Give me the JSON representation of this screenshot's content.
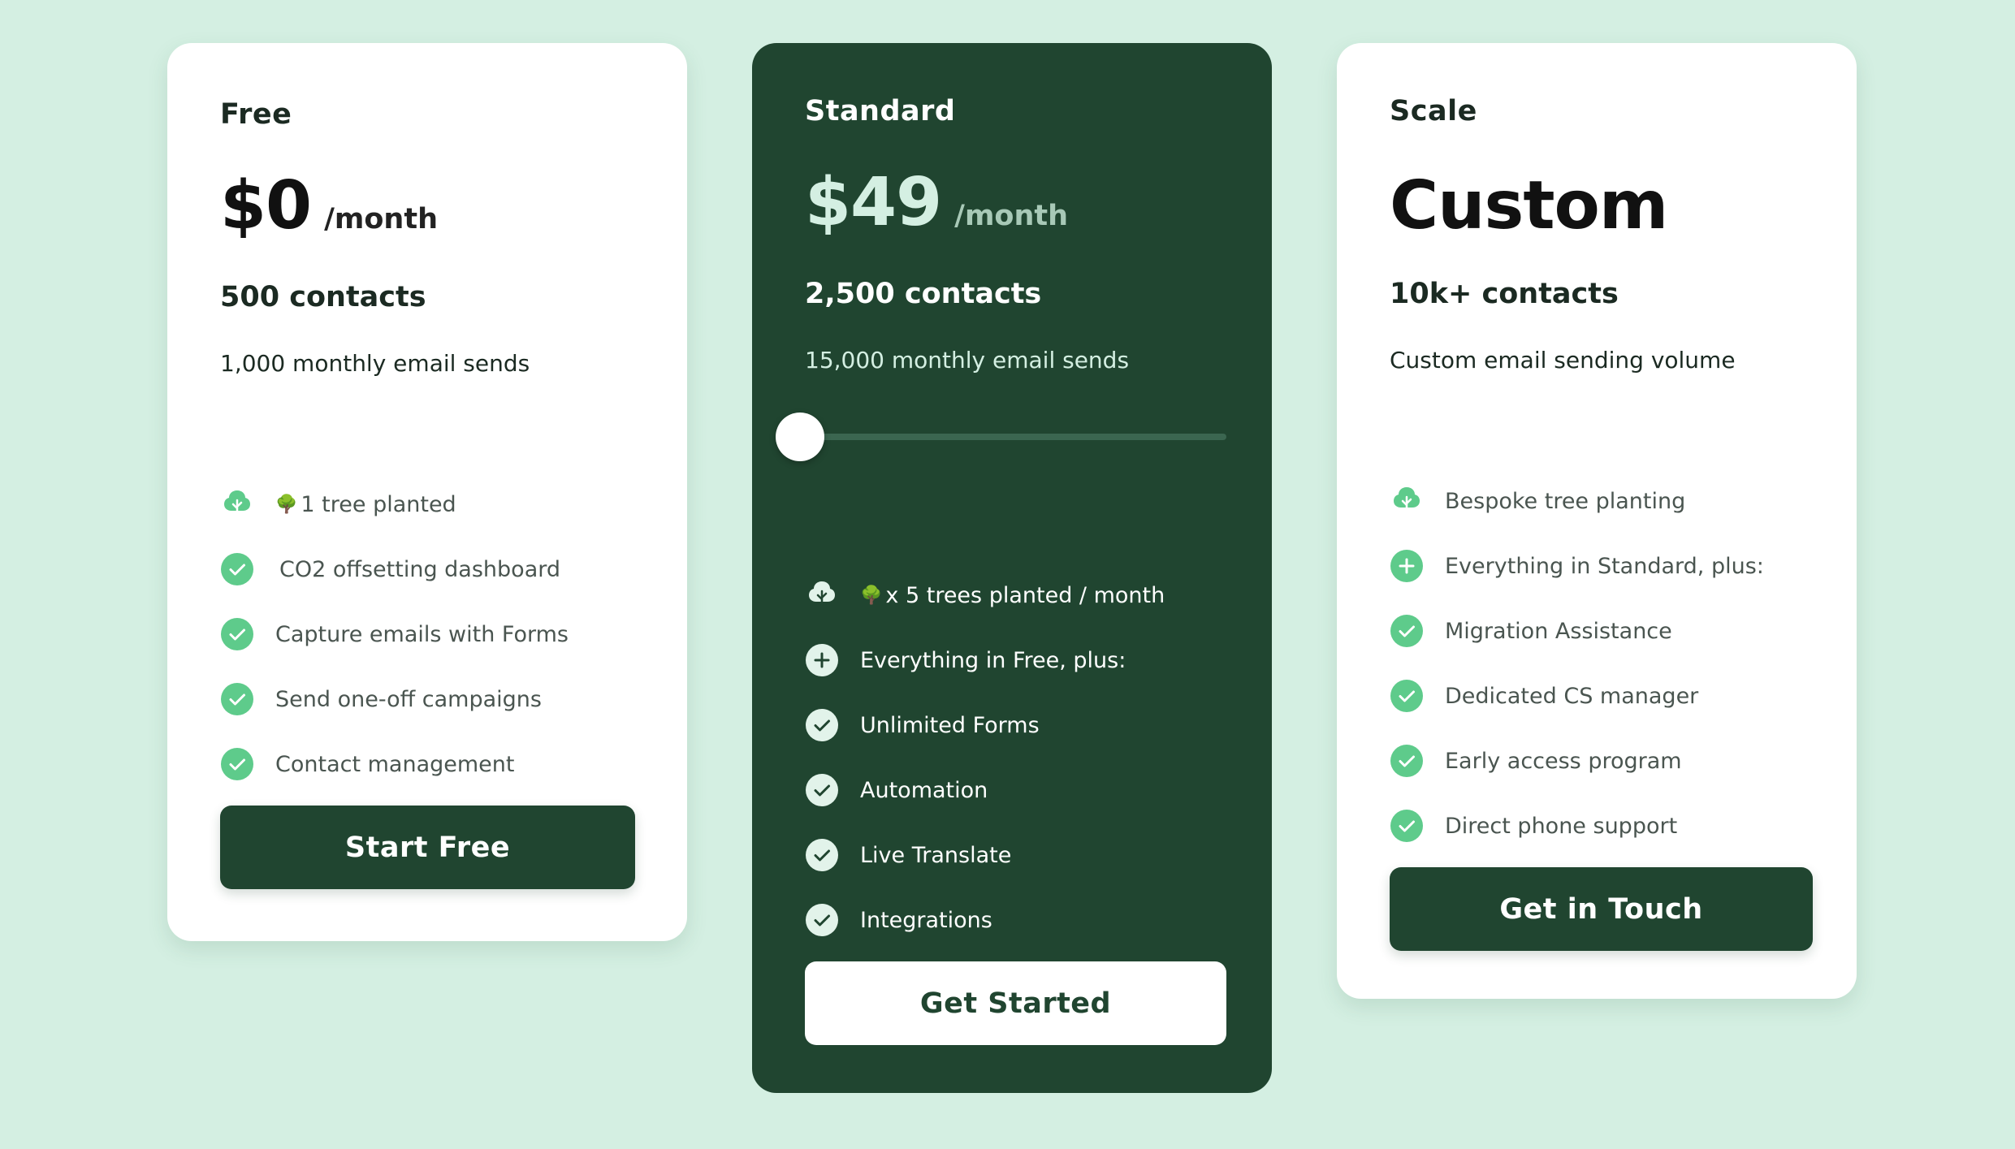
{
  "colors": {
    "page_bg": "#d4efe2",
    "dark_green": "#204530",
    "accent_green": "#5ecb8b",
    "price_standard": "#d4efe2"
  },
  "plans": [
    {
      "name": "Free",
      "price": "$0",
      "per": "/month",
      "contacts": "500 contacts",
      "sends": "1,000 monthly email sends",
      "features": [
        {
          "icon": "tree-icon",
          "emoji": "🌳",
          "label": "1 tree planted"
        },
        {
          "icon": "check-circle-icon",
          "label": "CO2 offsetting dashboard"
        },
        {
          "icon": "check-circle-icon",
          "label": "Capture emails with Forms"
        },
        {
          "icon": "check-circle-icon",
          "label": "Send one-off campaigns"
        },
        {
          "icon": "check-circle-icon",
          "label": "Contact management"
        }
      ],
      "cta": "Start Free"
    },
    {
      "name": "Standard",
      "price": "$49",
      "per": "/month",
      "contacts": "2,500 contacts",
      "sends": "15,000 monthly email sends",
      "slider_value": 0,
      "features": [
        {
          "icon": "tree-icon",
          "emoji": "🌳",
          "label": "x 5 trees planted / month"
        },
        {
          "icon": "plus-circle-icon",
          "label": "Everything in Free, plus:"
        },
        {
          "icon": "check-circle-icon",
          "label": "Unlimited Forms"
        },
        {
          "icon": "check-circle-icon",
          "label": "Automation"
        },
        {
          "icon": "check-circle-icon",
          "label": "Live Translate"
        },
        {
          "icon": "check-circle-icon",
          "label": "Integrations"
        }
      ],
      "cta": "Get Started"
    },
    {
      "name": "Scale",
      "price": "Custom",
      "contacts": "10k+ contacts",
      "sends": "Custom email sending volume",
      "features": [
        {
          "icon": "tree-icon",
          "label": "Bespoke tree planting"
        },
        {
          "icon": "plus-circle-icon",
          "label": "Everything in Standard, plus:"
        },
        {
          "icon": "check-circle-icon",
          "label": "Migration Assistance"
        },
        {
          "icon": "check-circle-icon",
          "label": "Dedicated CS manager"
        },
        {
          "icon": "check-circle-icon",
          "label": "Early access program"
        },
        {
          "icon": "check-circle-icon",
          "label": "Direct phone support"
        }
      ],
      "cta": "Get in Touch"
    }
  ]
}
